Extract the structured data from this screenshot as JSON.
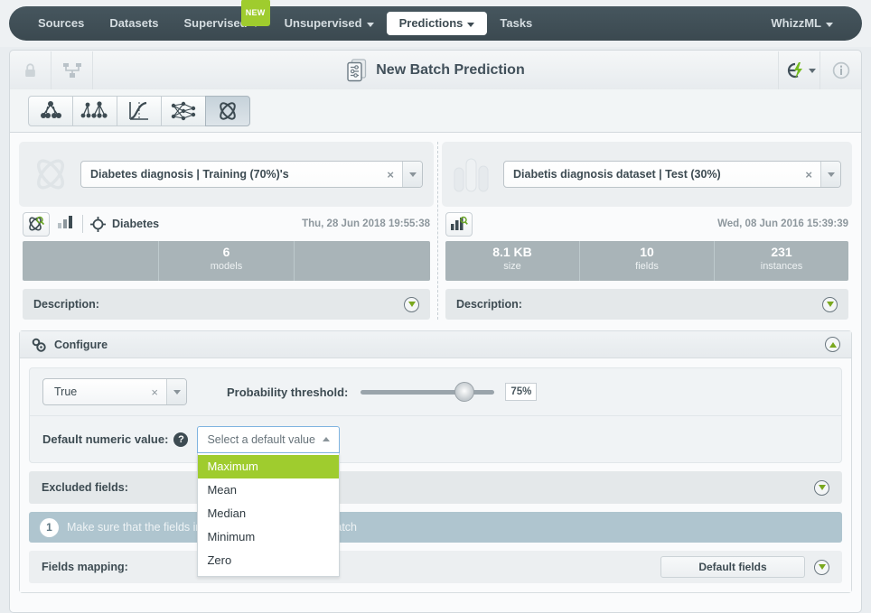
{
  "nav": {
    "items": [
      {
        "label": "Sources",
        "caret": false,
        "active": false,
        "badge": null
      },
      {
        "label": "Datasets",
        "caret": false,
        "active": false,
        "badge": null
      },
      {
        "label": "Supervised",
        "caret": true,
        "active": false,
        "badge": "NEW"
      },
      {
        "label": "Unsupervised",
        "caret": true,
        "active": false,
        "badge": null
      },
      {
        "label": "Predictions",
        "caret": true,
        "active": true,
        "badge": null
      },
      {
        "label": "Tasks",
        "caret": false,
        "active": false,
        "badge": null
      }
    ],
    "right": {
      "label": "WhizzML",
      "caret": true
    }
  },
  "header": {
    "title": "New Batch Prediction",
    "lock_icon": "lock-icon",
    "share_icon": "share-network-icon",
    "title_icon": "batch-prediction-icon",
    "action_icon": "whizzml-lightning-icon",
    "info_icon": "info-icon"
  },
  "type_toolbar": {
    "buttons": [
      {
        "name": "model-icon",
        "selected": false
      },
      {
        "name": "ensemble-icon",
        "selected": false
      },
      {
        "name": "logistic-regression-icon",
        "selected": false
      },
      {
        "name": "deepnet-icon",
        "selected": false
      },
      {
        "name": "fusion-icon",
        "selected": true
      }
    ]
  },
  "left_panel": {
    "icon": "fusion-icon",
    "selected_resource": "Diabetes diagnosis | Training (70%)'s",
    "clear_label": "×",
    "preview_icon": "fusion-preview-icon",
    "chart_icon": "bars-icon",
    "objective_icon": "target-icon",
    "objective_name": "Diabetes",
    "date": "Thu, 28 Jun 2018 19:55:38",
    "stats": [
      {
        "value": "",
        "label": ""
      },
      {
        "value": "6",
        "label": "models"
      },
      {
        "value": "",
        "label": ""
      }
    ],
    "description_label": "Description:"
  },
  "right_panel": {
    "icon": "dataset-icon",
    "selected_resource": "Diabetis diagnosis dataset | Test (30%)",
    "clear_label": "×",
    "preview_icon": "dataset-preview-icon",
    "date": "Wed, 08 Jun 2016 15:39:39",
    "stats": [
      {
        "value": "8.1 KB",
        "label": "size"
      },
      {
        "value": "10",
        "label": "fields"
      },
      {
        "value": "231",
        "label": "instances"
      }
    ],
    "description_label": "Description:"
  },
  "configure": {
    "title": "Configure",
    "gear_icon": "gears-icon",
    "collapse_icon": "collapse-up-icon",
    "positive_class": {
      "value": "True",
      "clear_label": "×"
    },
    "probability_threshold": {
      "label": "Probability threshold:",
      "value": "75%",
      "percent": 75
    },
    "default_numeric": {
      "label": "Default numeric value:",
      "help_icon": "question-mark-icon",
      "placeholder": "Select a default value",
      "open": true,
      "options": [
        {
          "label": "Maximum",
          "highlighted": true
        },
        {
          "label": "Mean",
          "highlighted": false
        },
        {
          "label": "Median",
          "highlighted": false
        },
        {
          "label": "Minimum",
          "highlighted": false
        },
        {
          "label": "Zero",
          "highlighted": false
        }
      ]
    },
    "excluded_fields": {
      "label": "Excluded fields:",
      "toggle_icon": "expand-down-icon"
    },
    "note": {
      "number": "1",
      "text": "Make sure that the fields in your model and dataset match"
    },
    "fields_mapping": {
      "label": "Fields mapping:",
      "button_label": "Default fields",
      "toggle_icon": "expand-down-icon"
    }
  },
  "colors": {
    "nav_bg": "#3b4950",
    "accent_green": "#9fcc2e",
    "stat_bar": "#a9b4b8",
    "note_bar": "#afc5cf",
    "text_dark": "#3d4b52"
  }
}
